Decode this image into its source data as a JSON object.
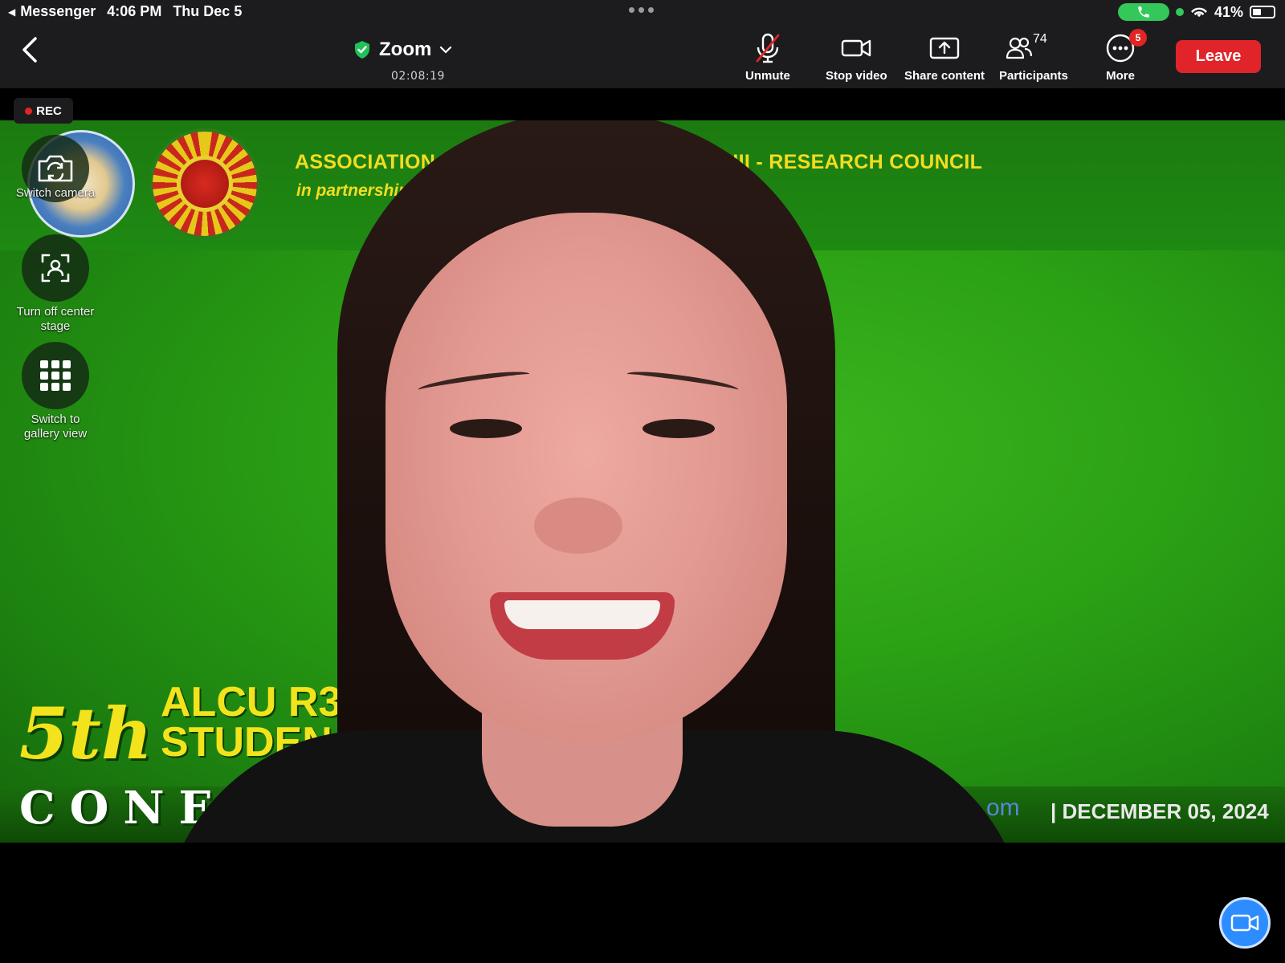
{
  "status_bar": {
    "back_app": "Messenger",
    "time": "4:06 PM",
    "date": "Thu Dec 5",
    "battery": "41%",
    "battery_level": 0.41
  },
  "toolbar": {
    "title": "Zoom",
    "timer": "02:08:19",
    "unmute_label": "Unmute",
    "stop_video_label": "Stop video",
    "share_label": "Share content",
    "participants_label": "Participants",
    "participants_count": "74",
    "more_label": "More",
    "more_badge": "5",
    "leave_label": "Leave"
  },
  "recording": {
    "label": "REC"
  },
  "side_controls": {
    "switch_camera": "Switch camera",
    "center_stage": "Turn off center stage",
    "gallery": "Switch to gallery view"
  },
  "video_background": {
    "org_line": "ASSOCIATION O                    ND UNIVERSITIES REGION III - RESEARCH COUNCIL",
    "partner_line": "in partnership v                                      LEGE",
    "event_5th": "5th",
    "event_alcu": "ALCU R3",
    "event_student": "STUDEN",
    "event_conf": "CONF",
    "event_url": "om",
    "event_date": "| DECEMBER 05, 2024"
  },
  "colors": {
    "leave": "#e0242a",
    "accent_blue": "#2d8cff",
    "rec_red": "#e02525",
    "call_green": "#34c759",
    "banner_yellow": "#f4dc20"
  }
}
